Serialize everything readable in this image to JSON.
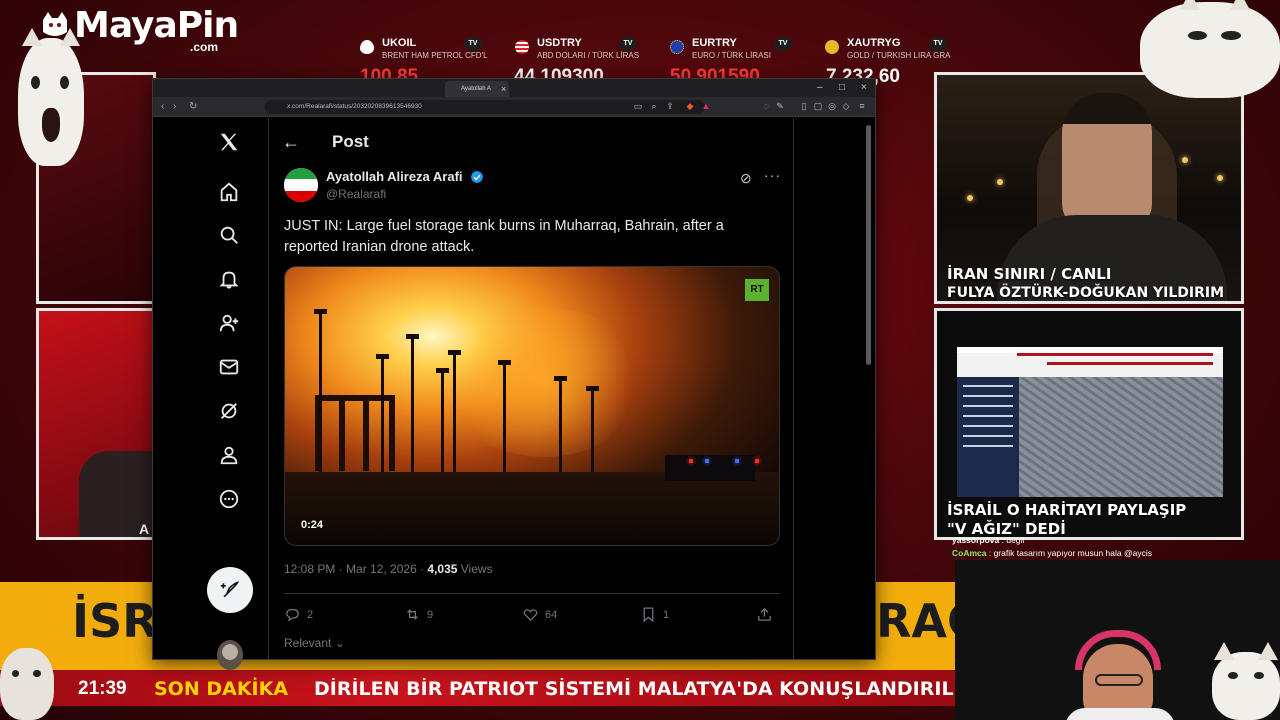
{
  "brand": {
    "logo_word": "MayaPin",
    "logo_suffix": ".com"
  },
  "tickers": [
    {
      "symbol": "UKOIL",
      "desc": "BRENT HAM PETROL CFD'L",
      "price": "100,85",
      "price_color": "#ff3b3b",
      "icon": "oil-drop-icon",
      "icon_color": "#111111",
      "badge": "TV"
    },
    {
      "symbol": "USDTRY",
      "desc": "ABD DOLARI / TÜRK LİRAS",
      "price": "44,109300",
      "price_color": "#ffffff",
      "icon": "us-flag-icon",
      "icon_color": "#3b5bd8",
      "badge": "TV"
    },
    {
      "symbol": "EURTRY",
      "desc": "EURO / TÜRK LİRASI",
      "price": "50,901590",
      "price_color": "#ff3b3b",
      "icon": "eu-flag-icon",
      "icon_color": "#1f3fb0",
      "badge": "TV"
    },
    {
      "symbol": "XAUTRYG",
      "desc": "GOLD / TURKISH LIRA GRA",
      "price": "7,232,60",
      "price_color": "#ffffff",
      "icon": "gold-coin-icon",
      "icon_color": "#e8b829",
      "badge": "TV"
    }
  ],
  "tv": {
    "top_right_caption_1": "İRAN SINIRI / CANLI",
    "top_right_caption_2": "FULYA ÖZTÜRK-DOĞUKAN YILDIRIM",
    "bottom_right_caption_1": "İSRAİL O HARİTAYI PAYLAŞIP",
    "bottom_right_caption_2": "\"V       AĞIZ\" DEDİ",
    "bottom_left_fragment": "A",
    "headline_left": "İSR",
    "headline_right": "RAC",
    "clock": "21:39",
    "breaking_label": "SON DAKİKA",
    "crawl_text": "DİRİLEN BİR PATRIOT SİSTEMİ MALATYA'DA KONUŞLANDIRILMAKT"
  },
  "chat": [
    {
      "user": "yassorpova",
      "message": "degil"
    },
    {
      "user": "CoAmca",
      "message": "grafik tasarım yapıyor musun hala @aycis"
    }
  ],
  "browser": {
    "tab_title": "Ayatollah A",
    "url": "x.com/Realarafi/status/2032020839613546930"
  },
  "x": {
    "page_title": "Post",
    "author_name": "Ayatollah Alireza Arafi",
    "author_handle": "@Realarafi",
    "tweet_text": "JUST IN: Large fuel storage tank burns in Muharraq, Bahrain, after a reported Iranian drone attack.",
    "media_badge": "RT",
    "video_duration": "0:24",
    "timestamp": "12:08 PM · Mar 12, 2026 · ",
    "views_count": "4,035",
    "views_label": " Views",
    "replies": "2",
    "reposts": "9",
    "likes": "64",
    "bookmarks": "1",
    "sort_label": "Relevant",
    "accent": "#1d9bf0"
  }
}
